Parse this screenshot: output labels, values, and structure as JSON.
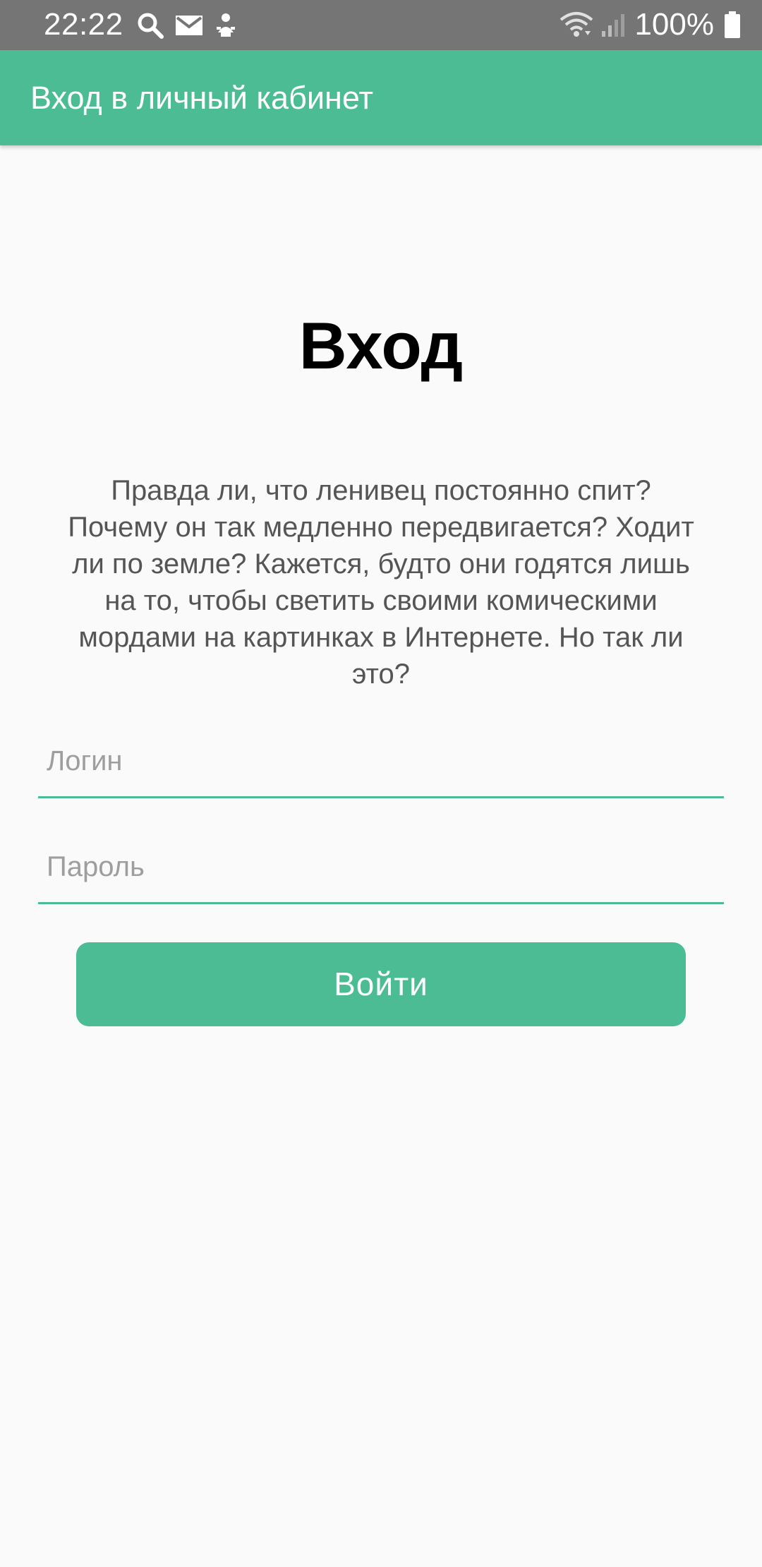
{
  "status_bar": {
    "time": "22:22",
    "battery_text": "100%",
    "left_icons": [
      "search-icon",
      "mail-icon",
      "notification-icon"
    ],
    "right_icons": [
      "wifi-icon",
      "signal-icon",
      "battery-icon"
    ]
  },
  "app_bar": {
    "title": "Вход в личный кабинет",
    "color": "#4bbc93"
  },
  "main": {
    "heading": "Вход",
    "description": "Правда ли, что ленивец постоянно спит? Почему он так медленно передвигается? Ходит ли по земле? Кажется, будто они годятся лишь на то, чтобы светить своими комическими мордами на картинках в Интернете. Но так ли это?",
    "login_field": {
      "placeholder": "Логин",
      "value": ""
    },
    "password_field": {
      "placeholder": "Пароль",
      "value": ""
    },
    "login_button_label": "Войти"
  },
  "colors": {
    "accent": "#4bbc93",
    "status_bar": "#757575",
    "background": "#fafafa"
  }
}
